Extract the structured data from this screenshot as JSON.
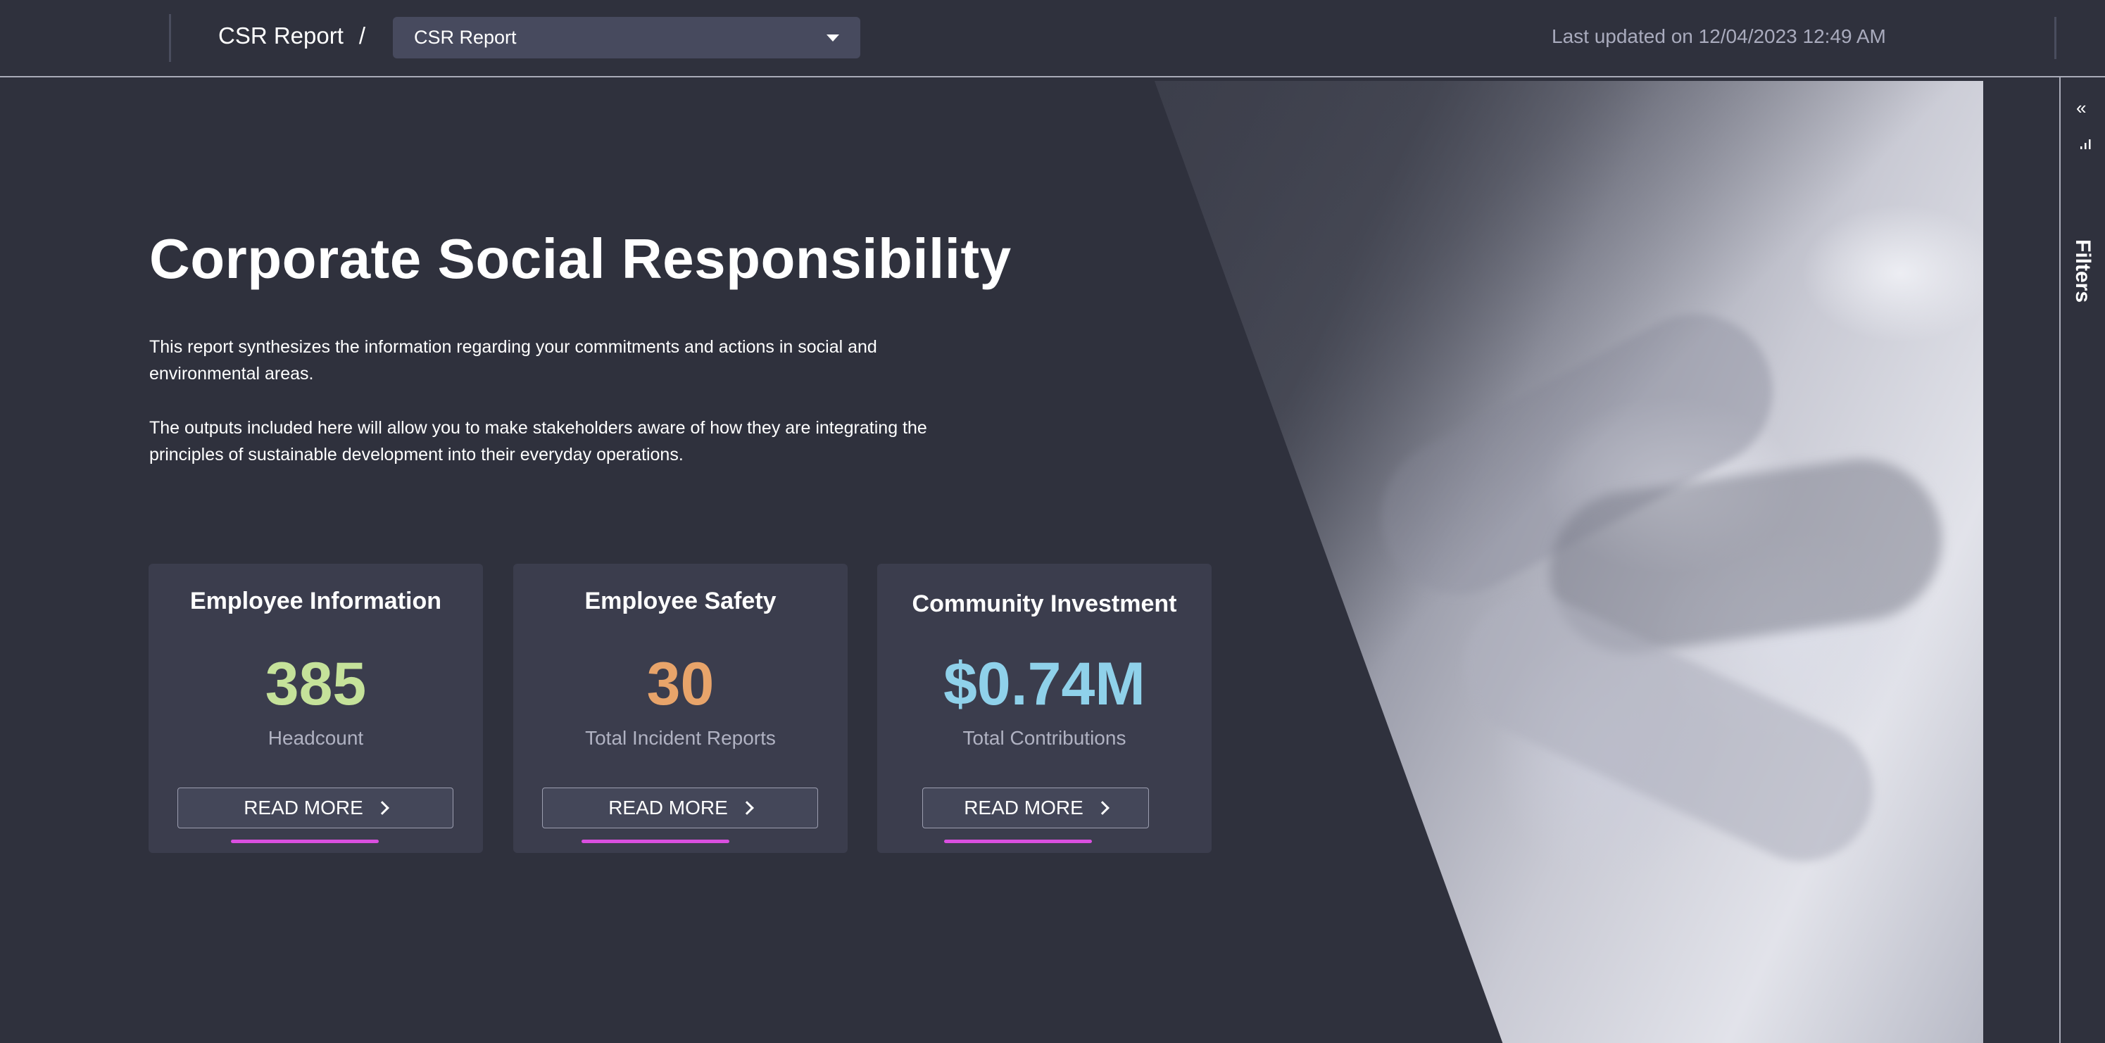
{
  "header": {
    "breadcrumb_root": "CSR Report",
    "breadcrumb_separator": "/",
    "selected_report": "CSR Report",
    "last_updated": "Last updated on 12/04/2023 12:49 AM"
  },
  "side_panel": {
    "label": "Filters",
    "collapse_glyph": "«",
    "icons": [
      "collapse-icon",
      "filter-icon"
    ]
  },
  "main": {
    "title": "Corporate Social Responsibility",
    "paragraphs": [
      "This report synthesizes the information regarding your commitments and actions in social and environmental areas.",
      "The outputs included here will allow you to make stakeholders aware of how they are integrating the principles of sustainable development into their everyday operations."
    ],
    "cards": [
      {
        "title": "Employee Information",
        "value": "385",
        "subtitle": "Headcount",
        "button": "READ MORE",
        "value_color": "#c5e29a"
      },
      {
        "title": "Employee Safety",
        "value": "30",
        "subtitle": "Total Incident Reports",
        "button": "READ MORE",
        "value_color": "#e8a46a"
      },
      {
        "title": "Community Investment",
        "value": "$0.74M",
        "subtitle": "Total Contributions",
        "button": "READ MORE",
        "value_color": "#8fd1ea"
      }
    ]
  },
  "colors": {
    "background": "#2f313d",
    "card": "#3b3d4d",
    "accent_underline": "#d94fe0"
  }
}
